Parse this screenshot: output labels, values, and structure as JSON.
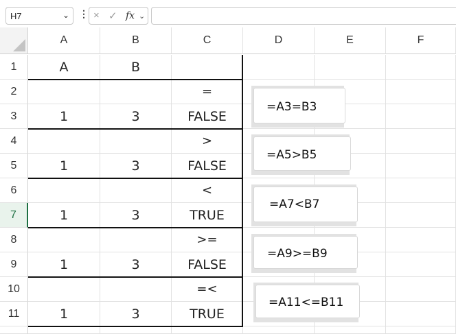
{
  "formula_bar": {
    "name_box": "H7",
    "name_box_chevron": "⌄",
    "dots": "⋮",
    "cancel_icon": "×",
    "enter_icon": "✓",
    "fx_label": "fx",
    "fx_chevron": "⌄",
    "formula": ""
  },
  "columns": [
    "A",
    "B",
    "C",
    "D",
    "E",
    "F"
  ],
  "rows": [
    "1",
    "2",
    "3",
    "4",
    "5",
    "6",
    "7",
    "8",
    "9",
    "10",
    "11"
  ],
  "active_row": "7",
  "cells": {
    "A1": "A",
    "B1": "B",
    "C2": "=",
    "A3": "1",
    "B3": "3",
    "C3": "FALSE",
    "C4": ">",
    "A5": "1",
    "B5": "3",
    "C5": "FALSE",
    "C6": "<",
    "A7": "1",
    "B7": "3",
    "C7": "TRUE",
    "C8": ">=",
    "A9": "1",
    "B9": "3",
    "C9": "FALSE",
    "C10": "=<",
    "A11": "1",
    "B11": "3",
    "C11": "TRUE"
  },
  "callouts": [
    "=A3=B3",
    "=A5>B5",
    "=A7<B7",
    "=A9>=B9",
    "=A11<=B11"
  ]
}
